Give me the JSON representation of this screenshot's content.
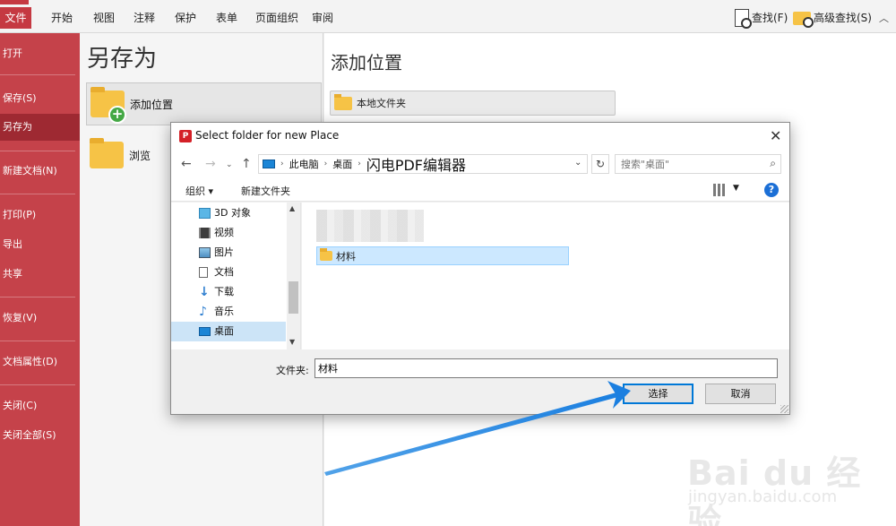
{
  "menubar": {
    "tabs": [
      {
        "label": "文件",
        "active": true
      },
      {
        "label": "开始"
      },
      {
        "label": "视图"
      },
      {
        "label": "注释"
      },
      {
        "label": "保护"
      },
      {
        "label": "表单"
      },
      {
        "label": "页面组织"
      },
      {
        "label": "审阅"
      }
    ],
    "find_label": "查找(F)",
    "advanced_find_label": "高级查找(S)",
    "accent_color": "#c53942"
  },
  "sidebar": {
    "items": [
      {
        "label": "打开"
      },
      {
        "label": "保存(S)"
      },
      {
        "label": "另存为",
        "active": true
      },
      {
        "label": "新建文档(N)"
      },
      {
        "label": "打印(P)"
      },
      {
        "label": "导出"
      },
      {
        "label": "共享"
      },
      {
        "label": "恢复(V)"
      },
      {
        "label": "文档属性(D)"
      },
      {
        "label": "关闭(C)"
      },
      {
        "label": "关闭全部(S)"
      }
    ],
    "color": "#c5424a"
  },
  "save_as": {
    "title": "另存为",
    "add_location_label": "添加位置",
    "browse_label": "浏览"
  },
  "add_location": {
    "title": "添加位置",
    "local_folder_label": "本地文件夹"
  },
  "dialog": {
    "title": "Select folder for new Place",
    "breadcrumb": [
      "此电脑",
      "桌面",
      "闪电PDF编辑器"
    ],
    "search_placeholder": "搜索\"桌面\"",
    "organize_label": "组织 ▾",
    "new_folder_label": "新建文件夹",
    "nav_items": [
      {
        "label": "3D 对象",
        "icon": "cube-3d-icon"
      },
      {
        "label": "视频",
        "icon": "video-icon"
      },
      {
        "label": "图片",
        "icon": "picture-icon"
      },
      {
        "label": "文档",
        "icon": "document-icon"
      },
      {
        "label": "下载",
        "icon": "download-icon"
      },
      {
        "label": "音乐",
        "icon": "music-icon"
      },
      {
        "label": "桌面",
        "icon": "desktop-icon",
        "selected": true
      }
    ],
    "selected_folder": "材料",
    "folder_label": "文件夹:",
    "folder_value": "材料",
    "select_button": "选择",
    "cancel_button": "取消"
  },
  "watermark": {
    "logo": "Bai du 经验",
    "url": "jingyan.baidu.com"
  }
}
